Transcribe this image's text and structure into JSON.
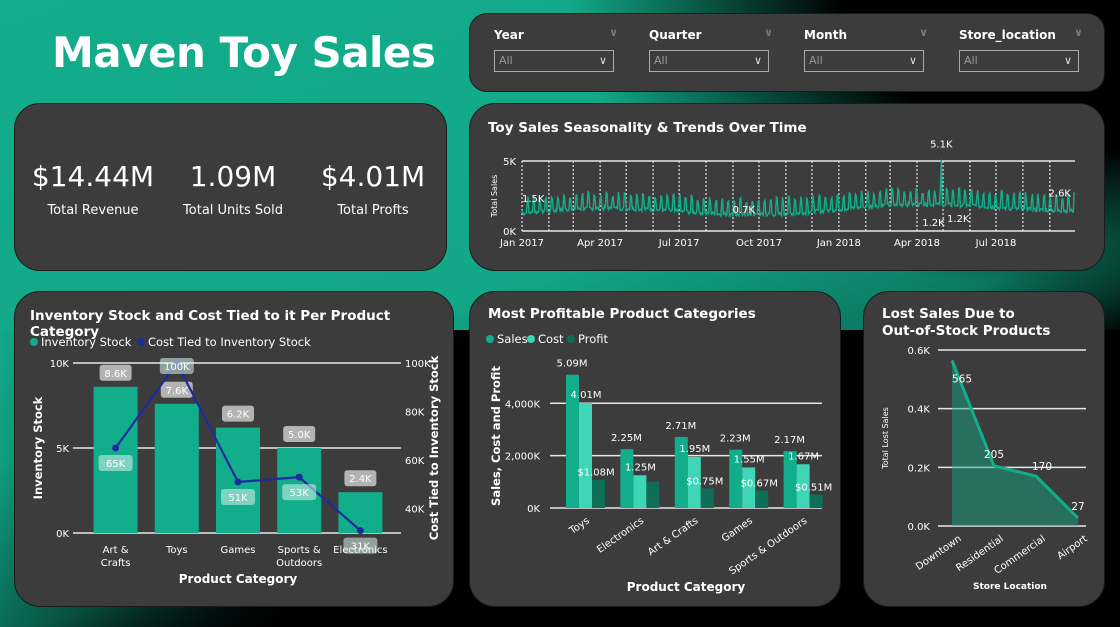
{
  "header": {
    "title": "Maven Toy Sales"
  },
  "slicers": [
    {
      "label": "Year",
      "value": "All"
    },
    {
      "label": "Quarter",
      "value": "All"
    },
    {
      "label": "Month",
      "value": "All"
    },
    {
      "label": "Store_location",
      "value": "All"
    }
  ],
  "kpis": [
    {
      "value": "$14.44M",
      "label": "Total Revenue"
    },
    {
      "value": "1.09M",
      "label": "Total Units Sold"
    },
    {
      "value": "$4.01M",
      "label": "Total Profts"
    }
  ],
  "colors": {
    "teal": "#12ae8c",
    "light_teal": "#3fd6b8",
    "dark_teal": "#0e6e58",
    "navy": "#1f2a9c",
    "card": "#3c3c3c"
  },
  "chart_data": [
    {
      "type": "line",
      "title": "Toy Sales Seasonality & Trends Over Time",
      "ylabel": "Total Sales",
      "xlabel": "",
      "ylim": [
        0,
        5000
      ],
      "yticks": [
        "0K",
        "5K"
      ],
      "xticks": [
        "Jan 2017",
        "Apr 2017",
        "Jul 2017",
        "Oct 2017",
        "Jan 2018",
        "Apr 2018",
        "Jul 2018"
      ],
      "x_range": [
        "2017-01-01",
        "2018-09-30"
      ],
      "annotations": [
        {
          "x": "2017-01-01",
          "label": "1.5K",
          "value": 1500
        },
        {
          "x": "2017-10-01",
          "label": "0.7K",
          "value": 700
        },
        {
          "x": "2018-04-29",
          "label": "5.1K",
          "value": 5100
        },
        {
          "x": "2018-05-01",
          "label": "1.2K",
          "value": 1200
        },
        {
          "x": "2018-04-20",
          "label": "1.2K",
          "value": 1200
        },
        {
          "x": "2018-09-30",
          "label": "2.6K",
          "value": 2600
        }
      ],
      "series": [
        {
          "name": "Total Sales",
          "note": "daily series oscillating weekly between ~0.7K and ~3.0K"
        }
      ],
      "grid": true
    },
    {
      "type": "bar",
      "title": "Inventory Stock and Cost Tied to it Per Product Category",
      "xlabel": "Product Category",
      "ylabel": "Inventory Stock",
      "y2label": "Cost Tied to Inventory Stock",
      "categories": [
        "Art & Crafts",
        "Toys",
        "Games",
        "Sports & Outdoors",
        "Electronics"
      ],
      "category_lines": [
        [
          "Art &",
          "Crafts"
        ],
        [
          "Toys"
        ],
        [
          "Games"
        ],
        [
          "Sports &",
          "Outdoors"
        ],
        [
          "Electronics"
        ]
      ],
      "ylim": [
        0,
        10000
      ],
      "yticks": [
        "0K",
        "5K",
        "10K"
      ],
      "y2lim": [
        30000,
        100000
      ],
      "y2ticks": [
        "40K",
        "60K",
        "80K",
        "100K"
      ],
      "legend": "top-left",
      "series": [
        {
          "name": "Inventory Stock",
          "type": "bar",
          "values": [
            8600,
            7600,
            6200,
            5000,
            2400
          ],
          "labels": [
            "8.6K",
            "7.6K",
            "6.2K",
            "5.0K",
            "2.4K"
          ]
        },
        {
          "name": "Cost Tied to Inventory Stock",
          "type": "line",
          "values": [
            65000,
            100000,
            51000,
            53000,
            31000
          ],
          "labels": [
            "65K",
            "100K",
            "51K",
            "53K",
            "31K"
          ]
        }
      ],
      "grid": true
    },
    {
      "type": "bar",
      "title": "Most Profitable Product Categories",
      "xlabel": "Product Category",
      "ylabel": "Sales, Cost and Profit",
      "categories": [
        "Toys",
        "Electronics",
        "Art & Crafts",
        "Games",
        "Sports & Outdoors"
      ],
      "ylim": [
        0,
        5500000
      ],
      "yticks": [
        "0K",
        "2,000K",
        "4,000K"
      ],
      "legend": "top-left",
      "series": [
        {
          "name": "Sales",
          "values": [
            5090000,
            2250000,
            2710000,
            2230000,
            2170000
          ],
          "labels": [
            "5.09M",
            "2.25M",
            "2.71M",
            "2.23M",
            "2.17M"
          ]
        },
        {
          "name": "Cost",
          "values": [
            4010000,
            1250000,
            1950000,
            1550000,
            1670000
          ],
          "labels": [
            "4.01M",
            "1.25M",
            "1.95M",
            "1.55M",
            "1.67M"
          ]
        },
        {
          "name": "Profit",
          "values": [
            1080000,
            1000000,
            750000,
            670000,
            510000
          ],
          "labels": [
            "$1.08M",
            "",
            "$0.75M",
            "$0.67M",
            "$0.51M"
          ]
        }
      ],
      "grid": true
    },
    {
      "type": "area",
      "title": "Lost Sales Due to Out-of-Stock Products",
      "title_lines": [
        "Lost Sales Due to",
        "Out-of-Stock Products"
      ],
      "xlabel": "Store Location",
      "ylabel": "Total Lost Sales",
      "categories": [
        "Downtown",
        "Residential",
        "Commercial",
        "Airport"
      ],
      "values": [
        565,
        205,
        170,
        27
      ],
      "labels": [
        "565",
        "205",
        "170",
        "27"
      ],
      "ylim": [
        0,
        600
      ],
      "yticks": [
        "0.0K",
        "0.2K",
        "0.4K",
        "0.6K"
      ],
      "grid": true
    }
  ]
}
